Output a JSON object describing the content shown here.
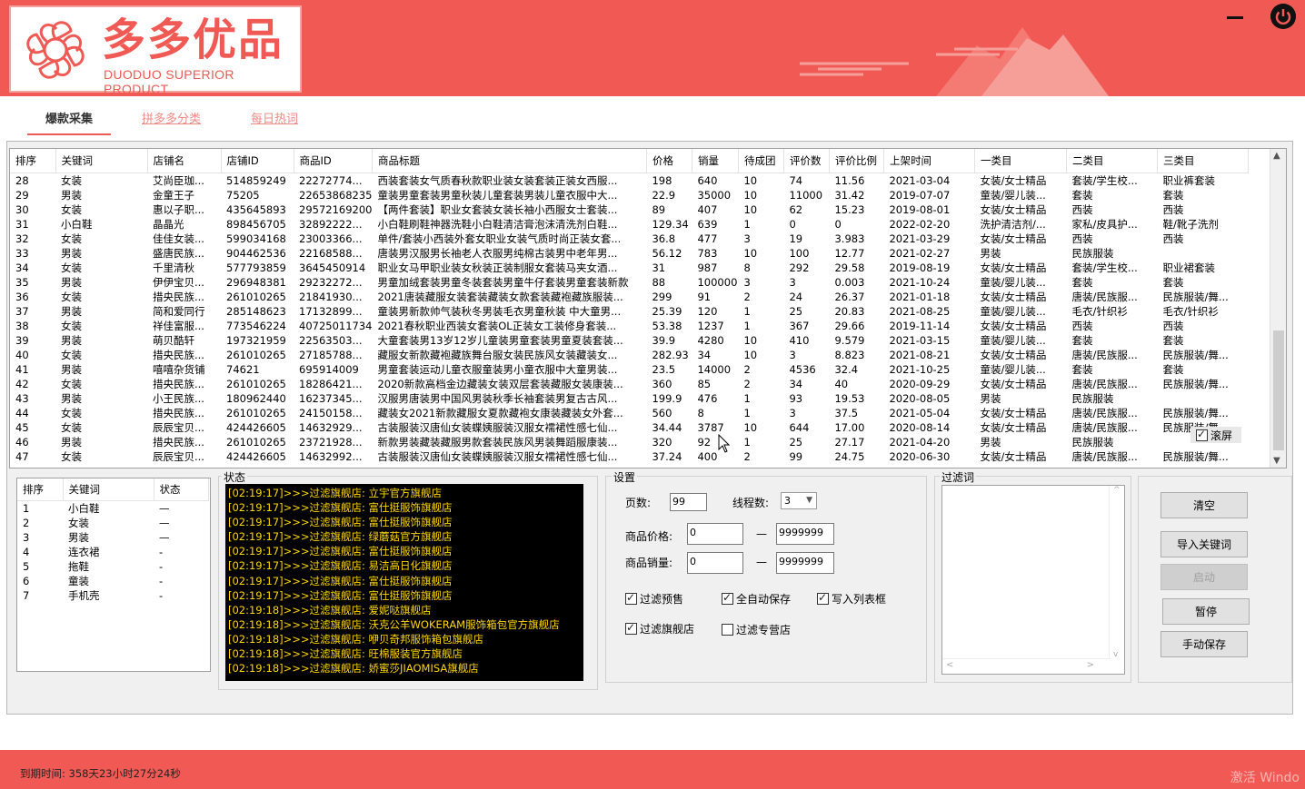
{
  "brand": {
    "name_cn": "多多优品",
    "name_en": "DUODUO SUPERIOR PRODUCT",
    "accent_color": "#f15a54"
  },
  "window_controls": {
    "minimize_icon": "minimize-icon",
    "power_icon": "power-icon"
  },
  "tabs": [
    {
      "label": "爆款采集",
      "active": true
    },
    {
      "label": "拼多多分类",
      "active": false
    },
    {
      "label": "每日热词",
      "active": false
    }
  ],
  "grid": {
    "headers": [
      "排序",
      "关键词",
      "店铺名",
      "店铺ID",
      "商品ID",
      "商品标题",
      "价格",
      "销量",
      "待成团",
      "评价数",
      "评价比例",
      "上架时间",
      "一类目",
      "二类目",
      "三类目"
    ],
    "rows": [
      [
        "28",
        "女装",
        "艾尚臣珈...",
        "514859249",
        "22272774...",
        "西装套装女气质春秋款职业装女装套装正装女西服...",
        "198",
        "640",
        "10",
        "74",
        "11.56",
        "2021-03-04",
        "女装/女士精品",
        "套装/学生校...",
        "职业裤套装"
      ],
      [
        "29",
        "男装",
        "金童王子",
        "75205",
        "22653868235",
        "童装男童套装男童秋装儿童套装男装儿童衣服中大...",
        "22.9",
        "35000",
        "10",
        "11000",
        "31.42",
        "2019-07-07",
        "童装/婴儿装...",
        "套装",
        "套装"
      ],
      [
        "30",
        "女装",
        "惠以子职...",
        "435645893",
        "29572169200",
        "【两件套装】职业女套装女装长袖小西服女士套装...",
        "89",
        "407",
        "10",
        "62",
        "15.23",
        "2019-08-01",
        "女装/女士精品",
        "西装",
        "西装"
      ],
      [
        "31",
        "小白鞋",
        "晶晶光",
        "898456705",
        "32892222...",
        "小白鞋刷鞋神器洗鞋小白鞋清洁膏泡沫清洗剂白鞋...",
        "129.34",
        "639",
        "1",
        "0",
        "0",
        "2022-02-20",
        "洗护清洁剂/...",
        "家私/皮具护...",
        "鞋/靴子洗剂"
      ],
      [
        "32",
        "女装",
        "佳佳女装...",
        "599034168",
        "23003366...",
        "单件/套装小西装外套女职业女装气质时尚正装女套...",
        "36.8",
        "477",
        "3",
        "19",
        "3.983",
        "2021-03-29",
        "女装/女士精品",
        "西装",
        "西装"
      ],
      [
        "33",
        "男装",
        "盛唐民族...",
        "904462536",
        "22168588...",
        "唐装男汉服男长袖老人衣服男纯棉古装男中老年男...",
        "56.12",
        "783",
        "10",
        "100",
        "12.77",
        "2021-02-27",
        "男装",
        "民族服装",
        ""
      ],
      [
        "34",
        "女装",
        "千里清秋",
        "577793859",
        "3645450914",
        "职业女马甲职业装女秋装正装制服女套装马夹女酒...",
        "31",
        "987",
        "8",
        "292",
        "29.58",
        "2019-08-19",
        "女装/女士精品",
        "套装/学生校...",
        "职业裙套装"
      ],
      [
        "35",
        "男装",
        "伊伊宝贝...",
        "296948381",
        "29232272...",
        "男童加绒套装男童冬装套装男童牛仔套装男童套装新款",
        "88",
        "100000",
        "3",
        "3",
        "0.003",
        "2021-10-24",
        "童装/婴儿装...",
        "套装",
        "套装"
      ],
      [
        "36",
        "女装",
        "措央民族...",
        "261010265",
        "21841930...",
        "2021唐装藏服女装套装藏装女款套装藏袍藏族服装...",
        "299",
        "91",
        "2",
        "24",
        "26.37",
        "2021-01-18",
        "女装/女士精品",
        "唐装/民族服...",
        "民族服装/舞..."
      ],
      [
        "37",
        "男装",
        "简和爱同行",
        "285148623",
        "17132899...",
        "童装男新款帅气装秋冬男装毛衣男童秋装 中大童男...",
        "25.39",
        "120",
        "1",
        "25",
        "20.83",
        "2021-08-25",
        "童装/婴儿装...",
        "毛衣/针织衫",
        "毛衣/针织衫"
      ],
      [
        "38",
        "女装",
        "祥佳富服...",
        "773546224",
        "40725011734",
        "2021春秋职业西装女套装OL正装女工装修身套装...",
        "53.38",
        "1237",
        "1",
        "367",
        "29.66",
        "2019-11-14",
        "女装/女士精品",
        "西装",
        "西装"
      ],
      [
        "39",
        "男装",
        "萌贝酷轩",
        "197321959",
        "22563503...",
        "大童套装男13岁12岁儿童装男童套装男童夏装套装...",
        "39.9",
        "4280",
        "10",
        "410",
        "9.579",
        "2021-03-15",
        "童装/婴儿装...",
        "套装",
        "套装"
      ],
      [
        "40",
        "女装",
        "措央民族...",
        "261010265",
        "27185788...",
        "藏服女新款藏袍藏族舞台服女装民族风女装藏装女...",
        "282.93",
        "34",
        "10",
        "3",
        "8.823",
        "2021-08-21",
        "女装/女士精品",
        "唐装/民族服...",
        "民族服装/舞..."
      ],
      [
        "41",
        "男装",
        "嘻嘻杂货铺",
        "74621",
        "695914009",
        "男童套装运动儿童衣服童装男小童衣服中大童男装...",
        "23.5",
        "14000",
        "2",
        "4536",
        "32.4",
        "2021-10-25",
        "童装/婴儿装...",
        "套装",
        "套装"
      ],
      [
        "42",
        "女装",
        "措央民族...",
        "261010265",
        "18286421...",
        "2020新款高档金边藏装女装双层套装藏服女装康装...",
        "360",
        "85",
        "2",
        "34",
        "40",
        "2020-09-29",
        "女装/女士精品",
        "唐装/民族服...",
        "民族服装/舞..."
      ],
      [
        "43",
        "男装",
        "小王民族...",
        "180962440",
        "16237345...",
        "汉服男唐装男中国风男装秋季长袖套装男复古古风...",
        "199.9",
        "476",
        "1",
        "93",
        "19.53",
        "2020-08-05",
        "男装",
        "民族服装",
        ""
      ],
      [
        "44",
        "女装",
        "措央民族...",
        "261010265",
        "24150158...",
        "藏装女2021新款藏服女夏款藏袍女康装藏装女外套...",
        "560",
        "8",
        "1",
        "3",
        "37.5",
        "2021-05-04",
        "女装/女士精品",
        "唐装/民族服...",
        "民族服装/舞..."
      ],
      [
        "45",
        "女装",
        "辰辰宝贝...",
        "424426605",
        "14632929...",
        "古装服装汉唐仙女装蝶姨服装汉服女襦裙性感七仙...",
        "34.44",
        "3787",
        "10",
        "644",
        "17.00",
        "2020-08-14",
        "女装/女士精品",
        "唐装/民族服...",
        "民族服装/舞..."
      ],
      [
        "46",
        "男装",
        "措央民族...",
        "261010265",
        "23721928...",
        "新款男装藏装藏服男款套装民族风男装舞蹈服康装...",
        "320",
        "92",
        "1",
        "25",
        "27.17",
        "2021-04-20",
        "男装",
        "民族服装",
        ""
      ],
      [
        "47",
        "女装",
        "辰辰宝贝...",
        "424426605",
        "14632992...",
        "古装服装汉唐仙女装蝶姨服装汉服女襦裙性感七仙...",
        "37.24",
        "400",
        "2",
        "99",
        "24.75",
        "2020-06-30",
        "女装/女士精品",
        "唐装/民族服...",
        "民族服装/舞..."
      ]
    ],
    "scroll_checkbox_label": "滚屏"
  },
  "keywords": {
    "headers": [
      "排序",
      "关键词",
      "状态"
    ],
    "rows": [
      [
        "1",
        "小白鞋",
        "—"
      ],
      [
        "2",
        "女装",
        "—"
      ],
      [
        "3",
        "男装",
        "—"
      ],
      [
        "4",
        "连衣裙",
        "-"
      ],
      [
        "5",
        "拖鞋",
        "-"
      ],
      [
        "6",
        "童装",
        "-"
      ],
      [
        "7",
        "手机壳",
        "-"
      ]
    ]
  },
  "status": {
    "label": "状态",
    "log": [
      "[02:19:17]>>>过滤旗舰店: 立宇官方旗舰店",
      "[02:19:17]>>>过滤旗舰店: 富仕挺服饰旗舰店",
      "[02:19:17]>>>过滤旗舰店: 富仕挺服饰旗舰店",
      "[02:19:17]>>>过滤旗舰店: 绿蘑菇官方旗舰店",
      "[02:19:17]>>>过滤旗舰店: 富仕挺服饰旗舰店",
      "[02:19:17]>>>过滤旗舰店: 易洁高日化旗舰店",
      "[02:19:17]>>>过滤旗舰店: 富仕挺服饰旗舰店",
      "[02:19:17]>>>过滤旗舰店: 富仕挺服饰旗舰店",
      "[02:19:18]>>>过滤旗舰店: 爱妮哒旗舰店",
      "[02:19:18]>>>过滤旗舰店: 沃克公羊WOKERAM服饰箱包官方旗舰店",
      "[02:19:18]>>>过滤旗舰店: 咿贝奇邦服饰箱包旗舰店",
      "[02:19:18]>>>过滤旗舰店: 旺棉服装官方旗舰店",
      "[02:19:18]>>>过滤旗舰店: 娇蜜莎JIAOMISA旗舰店"
    ]
  },
  "settings": {
    "label": "设置",
    "pages_label": "页数:",
    "pages_value": "99",
    "threads_label": "线程数:",
    "threads_value": "3",
    "price_label": "商品价格:",
    "price_min": "0",
    "price_max": "9999999",
    "sales_label": "商品销量:",
    "sales_min": "0",
    "sales_max": "9999999",
    "dash": "—",
    "checkboxes": [
      {
        "label": "过滤预售",
        "checked": true
      },
      {
        "label": "全自动保存",
        "checked": true
      },
      {
        "label": "写入列表框",
        "checked": true
      },
      {
        "label": "过滤旗舰店",
        "checked": true
      },
      {
        "label": "过滤专营店",
        "checked": false
      }
    ]
  },
  "filter": {
    "label": "过滤词",
    "value": ""
  },
  "buttons": {
    "clear": "清空",
    "import": "导入关键词",
    "start": "启动",
    "pause": "暂停",
    "manual_save": "手动保存"
  },
  "footer": {
    "expiry": "到期时间: 358天23小时27分24秒",
    "watermark": "激活 Windo"
  }
}
